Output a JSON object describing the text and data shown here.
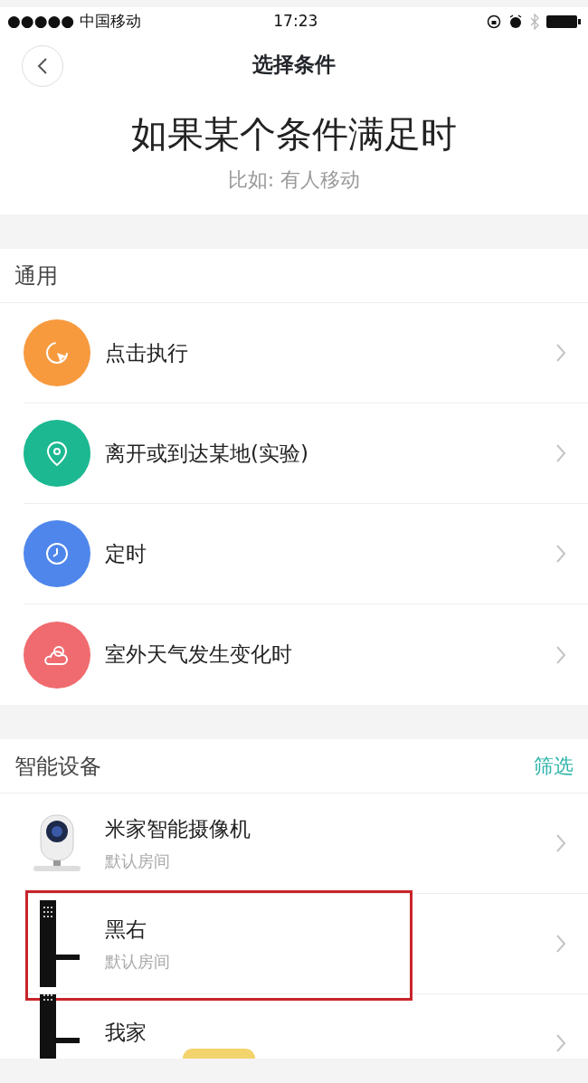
{
  "status_bar": {
    "carrier": "●●●●● 中国移动",
    "time": "17:23"
  },
  "nav": {
    "title": "选择条件"
  },
  "header": {
    "title": "如果某个条件满足时",
    "subtitle": "比如: 有人移动"
  },
  "general": {
    "title": "通用",
    "items": [
      {
        "label": "点击执行",
        "kind": "tap",
        "color": "#f79a3e"
      },
      {
        "label": "离开或到达某地(实验)",
        "kind": "location",
        "color": "#1bb891"
      },
      {
        "label": "定时",
        "kind": "clock",
        "color": "#4f86ec"
      },
      {
        "label": "室外天气发生变化时",
        "kind": "weather",
        "color": "#f06b6f"
      }
    ]
  },
  "devices": {
    "title": "智能设备",
    "filter": "筛选",
    "items": [
      {
        "name": "米家智能摄像机",
        "room": "默认房间",
        "kind": "camera",
        "highlighted": false
      },
      {
        "name": "黑右",
        "room": "默认房间",
        "kind": "lock",
        "highlighted": true
      },
      {
        "name": "我家",
        "kind": "lock",
        "highlighted": false,
        "tag": true
      }
    ]
  }
}
